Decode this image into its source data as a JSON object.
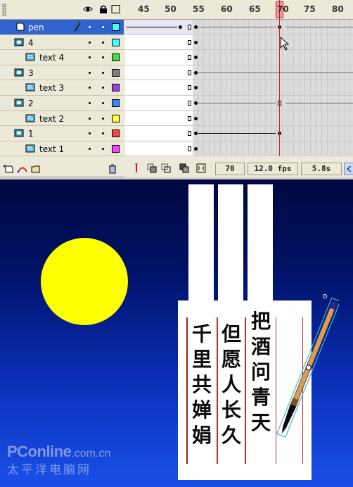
{
  "timeline": {
    "layers": [
      {
        "name": "pen",
        "type": "layer",
        "selected": true
      },
      {
        "name": "4",
        "type": "mask"
      },
      {
        "name": "text 4",
        "type": "masked"
      },
      {
        "name": "3",
        "type": "mask"
      },
      {
        "name": "text 3",
        "type": "masked"
      },
      {
        "name": "2",
        "type": "mask"
      },
      {
        "name": "text 2",
        "type": "masked"
      },
      {
        "name": "1",
        "type": "mask"
      },
      {
        "name": "text 1",
        "type": "masked"
      }
    ],
    "layer_colors": [
      "#40ffff",
      "#40ffff",
      "#40e040",
      "#808080",
      "#a040e0",
      "#4080ff",
      "#ffff40",
      "#ff4040",
      "#ff40ff"
    ],
    "ruler_labels": [
      "45",
      "50",
      "55",
      "60",
      "65",
      "70",
      "75",
      "80"
    ],
    "status": {
      "current_frame": "70",
      "frame_rate": "12.0 fps",
      "elapsed_time": "5.8s"
    }
  },
  "stage": {
    "poem_columns": [
      "把酒问青天",
      "但愿人长久",
      "千里共婵娟"
    ],
    "colors": {
      "moon": "#ffff00",
      "sky_top": "#000840",
      "sky_bottom": "#1a50e8",
      "border": "#b83030"
    },
    "watermark": {
      "brand": "PConline",
      "domain": ".com.cn",
      "cn": "太平洋电脑网"
    }
  }
}
